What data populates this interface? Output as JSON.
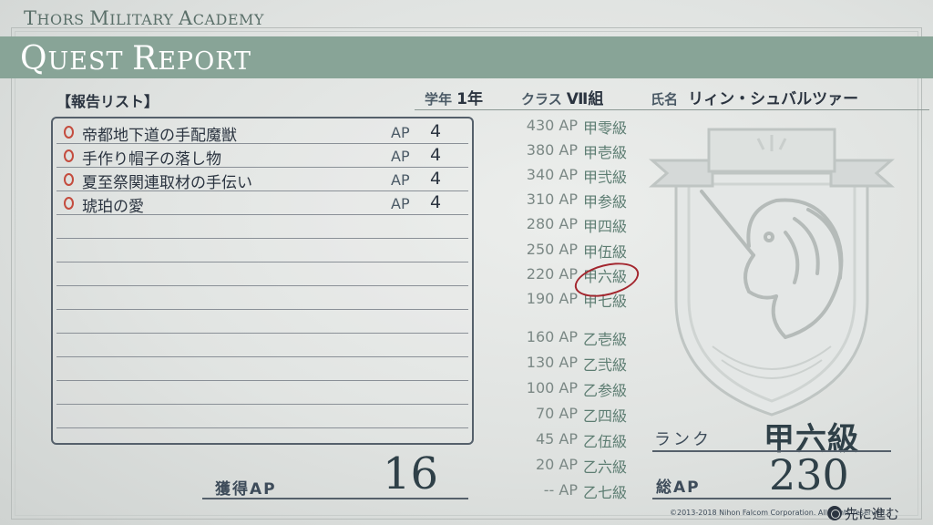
{
  "header": {
    "academy_first": "T",
    "academy_rest": "HORS ",
    "academy_m": "M",
    "academy_ilitary": "ILITARY ",
    "academy_a": "A",
    "academy_cademy": "CADEMY",
    "title_q": "Q",
    "title_uest": "UEST ",
    "title_r": "R",
    "title_eport": "EPORT"
  },
  "report_list": {
    "heading": "【報告リスト】",
    "quests": [
      {
        "name": "帝都地下道の手配魔獣",
        "ap_label": "AP",
        "ap": "4"
      },
      {
        "name": "手作り帽子の落し物",
        "ap_label": "AP",
        "ap": "4"
      },
      {
        "name": "夏至祭関連取材の手伝い",
        "ap_label": "AP",
        "ap": "4"
      },
      {
        "name": "琥珀の愛",
        "ap_label": "AP",
        "ap": "4"
      }
    ]
  },
  "student": {
    "year_label": "学年",
    "year_value": "1年",
    "class_label": "クラス",
    "class_value": "Ⅶ組",
    "name_label": "氏名",
    "name_value": "リィン・シュバルツァー"
  },
  "rank_table": [
    {
      "ap": "430 AP",
      "rank": "甲零級"
    },
    {
      "ap": "380 AP",
      "rank": "甲壱級"
    },
    {
      "ap": "340 AP",
      "rank": "甲弐級"
    },
    {
      "ap": "310 AP",
      "rank": "甲参級"
    },
    {
      "ap": "280 AP",
      "rank": "甲四級"
    },
    {
      "ap": "250 AP",
      "rank": "甲伍級"
    },
    {
      "ap": "220 AP",
      "rank": "甲六級"
    },
    {
      "ap": "190 AP",
      "rank": "甲七級"
    },
    {
      "ap": "160 AP",
      "rank": "乙壱級"
    },
    {
      "ap": "130 AP",
      "rank": "乙弐級"
    },
    {
      "ap": "100 AP",
      "rank": "乙参級"
    },
    {
      "ap": "70 AP",
      "rank": "乙四級"
    },
    {
      "ap": "45 AP",
      "rank": "乙伍級"
    },
    {
      "ap": "20 AP",
      "rank": "乙六級"
    },
    {
      "ap": "-- AP",
      "rank": "乙七級"
    }
  ],
  "summary": {
    "earned_label": "獲得AP",
    "earned_value": "16",
    "rank_label": "ランク",
    "rank_value": "甲六級",
    "total_label": "総AP",
    "total_value": "230"
  },
  "footer": {
    "copyright": "©2013-2018 Nihon Falcom Corporation. All rights reserved.",
    "next_label": "先に進む"
  },
  "colors": {
    "title_band": "#88a497",
    "highlight_circle": "#a3262e",
    "quest_icon": "#c44c3e"
  }
}
